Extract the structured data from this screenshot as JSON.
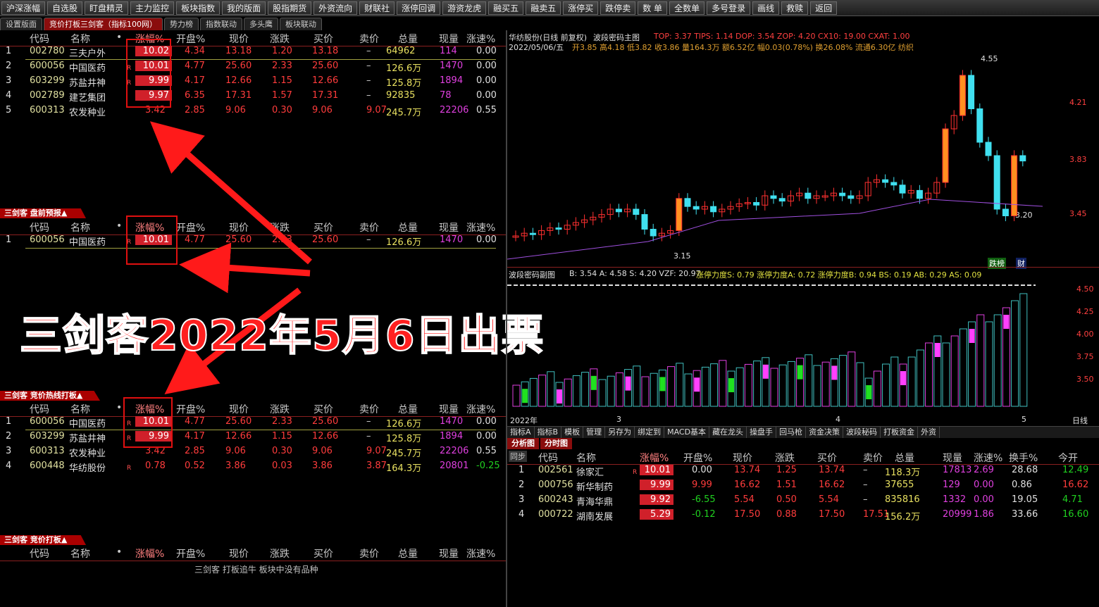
{
  "toolbar": [
    "沪深涨幅",
    "自选股",
    "盯盘精灵",
    "主力监控",
    "板块指数",
    "我的版面",
    "股指期货",
    "外资流向",
    "财联社",
    "涨停回调",
    "游资龙虎",
    "融买五",
    "融卖五",
    "涨停买",
    "跌停卖",
    "数 单",
    "全数单",
    "多号登录",
    "画线",
    "救赎",
    "返回"
  ],
  "tabs": [
    "设置版面",
    "竞价打板三剑客（指标100网）",
    "势力榜",
    "指数联动",
    "多头鹰",
    "板块联动"
  ],
  "columns": [
    "代码",
    "名称",
    "•",
    "涨幅%",
    "开盘%",
    "现价",
    "涨跌",
    "买价",
    "卖价",
    "总量",
    "现量",
    "涨速%"
  ],
  "table1": [
    {
      "idx": "1",
      "code": "002780",
      "name": "三夫户外",
      "flag": "",
      "pct": "10.02",
      "open": "4.34",
      "price": "13.18",
      "chg": "1.20",
      "bid": "13.18",
      "ask": "–",
      "vol": "64962",
      "cur": "114",
      "speed": "0.00"
    },
    {
      "idx": "2",
      "code": "600056",
      "name": "中国医药",
      "flag": "R",
      "pct": "10.01",
      "open": "4.77",
      "price": "25.60",
      "chg": "2.33",
      "bid": "25.60",
      "ask": "–",
      "vol": "126.6万",
      "cur": "1470",
      "speed": "0.00"
    },
    {
      "idx": "3",
      "code": "603299",
      "name": "苏盐井神",
      "flag": "R",
      "pct": "9.99",
      "open": "4.17",
      "price": "12.66",
      "chg": "1.15",
      "bid": "12.66",
      "ask": "–",
      "vol": "125.8万",
      "cur": "1894",
      "speed": "0.00"
    },
    {
      "idx": "4",
      "code": "002789",
      "name": "建艺集团",
      "flag": "",
      "pct": "9.97",
      "open": "6.35",
      "price": "17.31",
      "chg": "1.57",
      "bid": "17.31",
      "ask": "–",
      "vol": "92835",
      "cur": "78",
      "speed": "0.00"
    },
    {
      "idx": "5",
      "code": "600313",
      "name": "农发种业",
      "flag": "",
      "pct": "3.42",
      "open": "2.85",
      "price": "9.06",
      "chg": "0.30",
      "bid": "9.06",
      "ask": "9.07",
      "vol": "245.7万",
      "cur": "22206",
      "speed": "0.55"
    }
  ],
  "sec2_title": "三剑客 盘前预报▲",
  "table2": [
    {
      "idx": "1",
      "code": "600056",
      "name": "中国医药",
      "flag": "R",
      "pct": "10.01",
      "open": "4.77",
      "price": "25.60",
      "chg": "2.33",
      "bid": "25.60",
      "ask": "–",
      "vol": "126.6万",
      "cur": "1470",
      "speed": "0.00"
    }
  ],
  "sec3_title": "三剑客 竞价热线打板▲",
  "table3": [
    {
      "idx": "1",
      "code": "600056",
      "name": "中国医药",
      "flag": "R",
      "pct": "10.01",
      "open": "4.77",
      "price": "25.60",
      "chg": "2.33",
      "bid": "25.60",
      "ask": "–",
      "vol": "126.6万",
      "cur": "1470",
      "speed": "0.00"
    },
    {
      "idx": "2",
      "code": "603299",
      "name": "苏盐井神",
      "flag": "R",
      "pct": "9.99",
      "open": "4.17",
      "price": "12.66",
      "chg": "1.15",
      "bid": "12.66",
      "ask": "–",
      "vol": "125.8万",
      "cur": "1894",
      "speed": "0.00"
    },
    {
      "idx": "3",
      "code": "600313",
      "name": "农发种业",
      "flag": "",
      "pct": "3.42",
      "open": "2.85",
      "price": "9.06",
      "chg": "0.30",
      "bid": "9.06",
      "ask": "9.07",
      "vol": "245.7万",
      "cur": "22206",
      "speed": "0.55"
    },
    {
      "idx": "4",
      "code": "600448",
      "name": "华纺股份",
      "flag": "R",
      "pct": "0.78",
      "open": "0.52",
      "price": "3.86",
      "chg": "0.03",
      "bid": "3.86",
      "ask": "3.87",
      "vol": "164.3万",
      "cur": "20801",
      "speed": "-0.25"
    }
  ],
  "sec4_title": "三剑客 竞价打板▲",
  "empty_msg": "三剑客 打板追牛 板块中没有品种",
  "caption": "三剑客2022年5月6日出票",
  "chart": {
    "title": "华纺股份(日线 前复权)",
    "indicator": "波段密码主图",
    "top_vals": "TOP: 3.37  TIPS: 1.14  DOP: 3.54  ZOP: 4.20  CX10: 19.00  CXAT: 1.00",
    "date_line": "2022/05/06/五",
    "ohlc": "开3.85 高4.18 低3.82 收3.86 量164.3万 额6.52亿 幅0.03(0.78%) 换26.08% 流通6.30亿 纺织",
    "price_labels": [
      "4.21",
      "3.83",
      "3.45"
    ],
    "high_mark": "4.55",
    "low_mark": "3.15",
    "last_mark": "3.20",
    "badge1": "跌榜",
    "badge2": "财",
    "sub_title": "波段密码副图",
    "sub_vals": "B: 3.54  A: 4.58  S: 4.20  VZF: 20.97",
    "sub_vals2": "涨停力度S: 0.79  涨停力度A: 0.72  涨停力度B: 0.94  BS: 0.19  AB: 0.29  AS: 0.09",
    "sub_labels": [
      "4.50",
      "4.25",
      "4.00",
      "3.75",
      "3.50"
    ],
    "x_labels": [
      "2022年",
      "3",
      "4",
      "5"
    ],
    "period": "日线"
  },
  "subtabs": [
    "指标A",
    "指标B",
    "模板",
    "管理",
    "另存为",
    "绑定到",
    "MACD基本",
    "藏在龙头",
    "操盘手",
    "回马枪",
    "资金决策",
    "波段秘码",
    "打板资金",
    "外资"
  ],
  "analysis_tabs": [
    "分析图",
    "分时图"
  ],
  "analysis_columns": [
    "同步",
    "代码",
    "名称",
    "涨幅%",
    "开盘%",
    "现价",
    "涨跌",
    "买价",
    "卖价",
    "总量",
    "现量",
    "涨速%",
    "换手%",
    "今开"
  ],
  "analysis_rows": [
    {
      "idx": "1",
      "code": "002561",
      "name": "徐家汇",
      "flag": "R",
      "pct": "10.01",
      "open": "0.00",
      "price": "13.74",
      "chg": "1.25",
      "bid": "13.74",
      "ask": "–",
      "vol": "118.3万",
      "cur": "17813",
      "speed": "2.69",
      "turn": "28.68",
      "today": "12.49"
    },
    {
      "idx": "2",
      "code": "000756",
      "name": "新华制药",
      "flag": "",
      "pct": "9.99",
      "open": "9.99",
      "price": "16.62",
      "chg": "1.51",
      "bid": "16.62",
      "ask": "–",
      "vol": "37655",
      "cur": "129",
      "speed": "0.00",
      "turn": "0.86",
      "today": "16.62"
    },
    {
      "idx": "3",
      "code": "600243",
      "name": "青海华鼎",
      "flag": "",
      "pct": "9.92",
      "open": "-6.55",
      "price": "5.54",
      "chg": "0.50",
      "bid": "5.54",
      "ask": "–",
      "vol": "835816",
      "cur": "1332",
      "speed": "0.00",
      "turn": "19.05",
      "today": "4.71"
    },
    {
      "idx": "4",
      "code": "000722",
      "name": "湖南发展",
      "flag": "",
      "pct": "5.29",
      "open": "-0.12",
      "price": "17.50",
      "chg": "0.88",
      "bid": "17.50",
      "ask": "17.51",
      "vol": "156.2万",
      "cur": "20999",
      "speed": "1.86",
      "turn": "33.66",
      "today": "16.60"
    }
  ]
}
